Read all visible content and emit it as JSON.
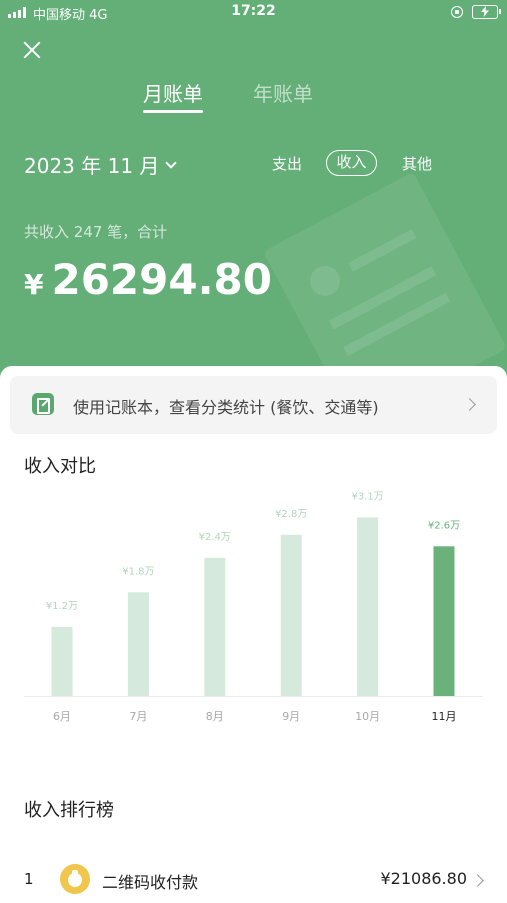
{
  "status_bar": {
    "carrier": "中国移动",
    "network": "4G",
    "time": "17:22"
  },
  "tabs": [
    {
      "label": "月账单",
      "active": true
    },
    {
      "label": "年账单",
      "active": false
    }
  ],
  "period": {
    "label": "2023 年 11 月"
  },
  "filters": [
    {
      "label": "支出",
      "active": false
    },
    {
      "label": "收入",
      "active": true
    },
    {
      "label": "其他",
      "active": false
    }
  ],
  "summary": {
    "text": "共收入 247 笔，合计",
    "currency": "¥",
    "amount": "26294.80"
  },
  "banner": {
    "text": "使用记账本，查看分类统计 (餐饮、交通等)"
  },
  "comparison": {
    "title": "收入对比"
  },
  "colors": {
    "header_green": "#64ae78",
    "bar_light": "#d5e9dc",
    "bar_active": "#6ab27a",
    "label_light": "#b2d5bc"
  },
  "chart_data": {
    "type": "bar",
    "categories": [
      "6月",
      "7月",
      "8月",
      "9月",
      "10月",
      "11月"
    ],
    "values": [
      1.2,
      1.8,
      2.4,
      2.8,
      3.1,
      2.6
    ],
    "value_labels": [
      "¥1.2万",
      "¥1.8万",
      "¥2.4万",
      "¥2.8万",
      "¥3.1万",
      "¥2.6万"
    ],
    "unit": "万",
    "highlight_index": 5,
    "grid": false
  },
  "ranking": {
    "title": "收入排行榜",
    "items": [
      {
        "rank": "1",
        "name": "二维码收付款",
        "amount": "¥21086.80",
        "icon": "coin-icon"
      }
    ]
  }
}
